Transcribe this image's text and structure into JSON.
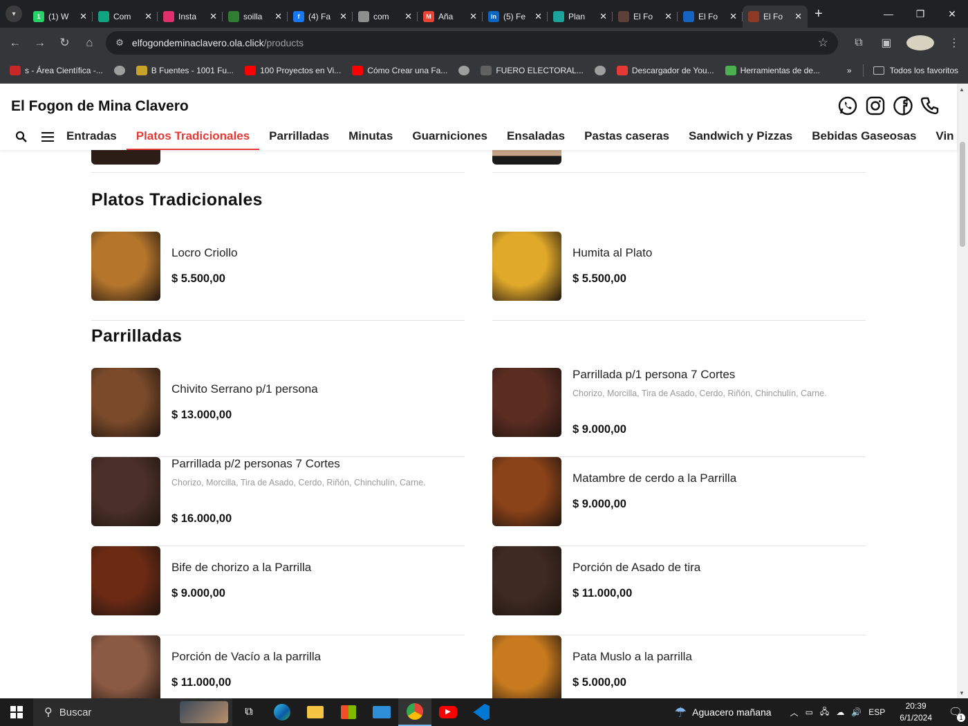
{
  "browser": {
    "tabs": [
      {
        "title": "(1) W",
        "fav_color": "#25d366",
        "fav_text": "1"
      },
      {
        "title": "Com",
        "fav_color": "#10a37f",
        "fav_text": ""
      },
      {
        "title": "Insta",
        "fav_color": "#e1306c",
        "fav_text": ""
      },
      {
        "title": "soilla",
        "fav_color": "#2e7d32",
        "fav_text": ""
      },
      {
        "title": "(4) Fa",
        "fav_color": "#1877f2",
        "fav_text": "f"
      },
      {
        "title": "com",
        "fav_color": "#8e8e8e",
        "fav_text": ""
      },
      {
        "title": "Aña",
        "fav_color": "#ea4335",
        "fav_text": "M"
      },
      {
        "title": "(5) Fe",
        "fav_color": "#0a66c2",
        "fav_text": "in"
      },
      {
        "title": "Plan",
        "fav_color": "#1ba39c",
        "fav_text": ""
      },
      {
        "title": "El Fo",
        "fav_color": "#5d4037",
        "fav_text": ""
      },
      {
        "title": "El Fo",
        "fav_color": "#1565c0",
        "fav_text": ""
      },
      {
        "title": "El Fo",
        "fav_color": "#8d3b24",
        "fav_text": ""
      }
    ],
    "url_host": "elfogondeminaclavero.ola.click",
    "url_path": "/products",
    "bookmarks": [
      {
        "label": "s - Área Científica -...",
        "color": "#c62828"
      },
      {
        "label": "",
        "color": "#9e9e9e"
      },
      {
        "label": "B Fuentes - 1001 Fu...",
        "color": "#c8a22a"
      },
      {
        "label": "100 Proyectos en Vi...",
        "color": "#ff0000"
      },
      {
        "label": "Cómo Crear una Fa...",
        "color": "#ff0000"
      },
      {
        "label": "",
        "color": "#9e9e9e"
      },
      {
        "label": "FUERO ELECTORAL...",
        "color": "#616161"
      },
      {
        "label": "",
        "color": "#9e9e9e"
      },
      {
        "label": "Descargador de You...",
        "color": "#e53935"
      },
      {
        "label": "Herramientas de de...",
        "color": "#4caf50"
      }
    ],
    "bookmarks_more": "»",
    "all_bookmarks": "Todos los favoritos"
  },
  "site": {
    "brand": "El Fogon de Mina Clavero",
    "categories": [
      "Entradas",
      "Platos Tradicionales",
      "Parrilladas",
      "Minutas",
      "Guarniciones",
      "Ensaladas",
      "Pastas caseras",
      "Sandwich y Pizzas",
      "Bebidas Gaseosas",
      "Vin"
    ],
    "active_category": "Platos Tradicionales"
  },
  "sections": [
    {
      "title": "Platos Tradicionales",
      "items": [
        {
          "name": "Locro Criollo",
          "desc": "",
          "price": "$ 5.500,00",
          "img_color": "#b5762c"
        },
        {
          "name": "Humita al Plato",
          "desc": "",
          "price": "$ 5.500,00",
          "img_color": "#e0a92a"
        }
      ]
    },
    {
      "title": "Parrilladas",
      "items": [
        {
          "name": "Chivito Serrano p/1 persona",
          "desc": "",
          "price": "$ 13.000,00",
          "img_color": "#7a4a2a"
        },
        {
          "name": "Parrillada p/1 persona 7 Cortes",
          "desc": "Chorizo, Morcilla, Tira de Asado, Cerdo, Riñón, Chinchulín, Carne.",
          "price": "$ 9.000,00",
          "img_color": "#5b2c22"
        },
        {
          "name": "Parrillada p/2 personas 7 Cortes",
          "desc": "Chorizo, Morcilla, Tira de Asado, Cerdo, Riñón, Chinchulín, Carne.",
          "price": "$ 16.000,00",
          "img_color": "#4a3028"
        },
        {
          "name": "Matambre de cerdo a la Parrilla",
          "desc": "",
          "price": "$ 9.000,00",
          "img_color": "#8a4218"
        },
        {
          "name": "Bife de chorizo a la Parrilla",
          "desc": "",
          "price": "$ 9.000,00",
          "img_color": "#6b2a14"
        },
        {
          "name": "Porción de Asado de tira",
          "desc": "",
          "price": "$ 11.000,00",
          "img_color": "#3d2a22"
        },
        {
          "name": "Porción de Vacío a la parrilla",
          "desc": "",
          "price": "$ 11.000,00",
          "img_color": "#8b5a44"
        },
        {
          "name": "Pata Muslo a la parrilla",
          "desc": "",
          "price": "$ 5.000,00",
          "img_color": "#c77a1e"
        }
      ]
    }
  ],
  "taskbar": {
    "search_placeholder": "Buscar",
    "weather": "Aguacero mañana",
    "lang": "ESP",
    "time": "20:39",
    "date": "6/1/2024",
    "notif_count": "1"
  }
}
